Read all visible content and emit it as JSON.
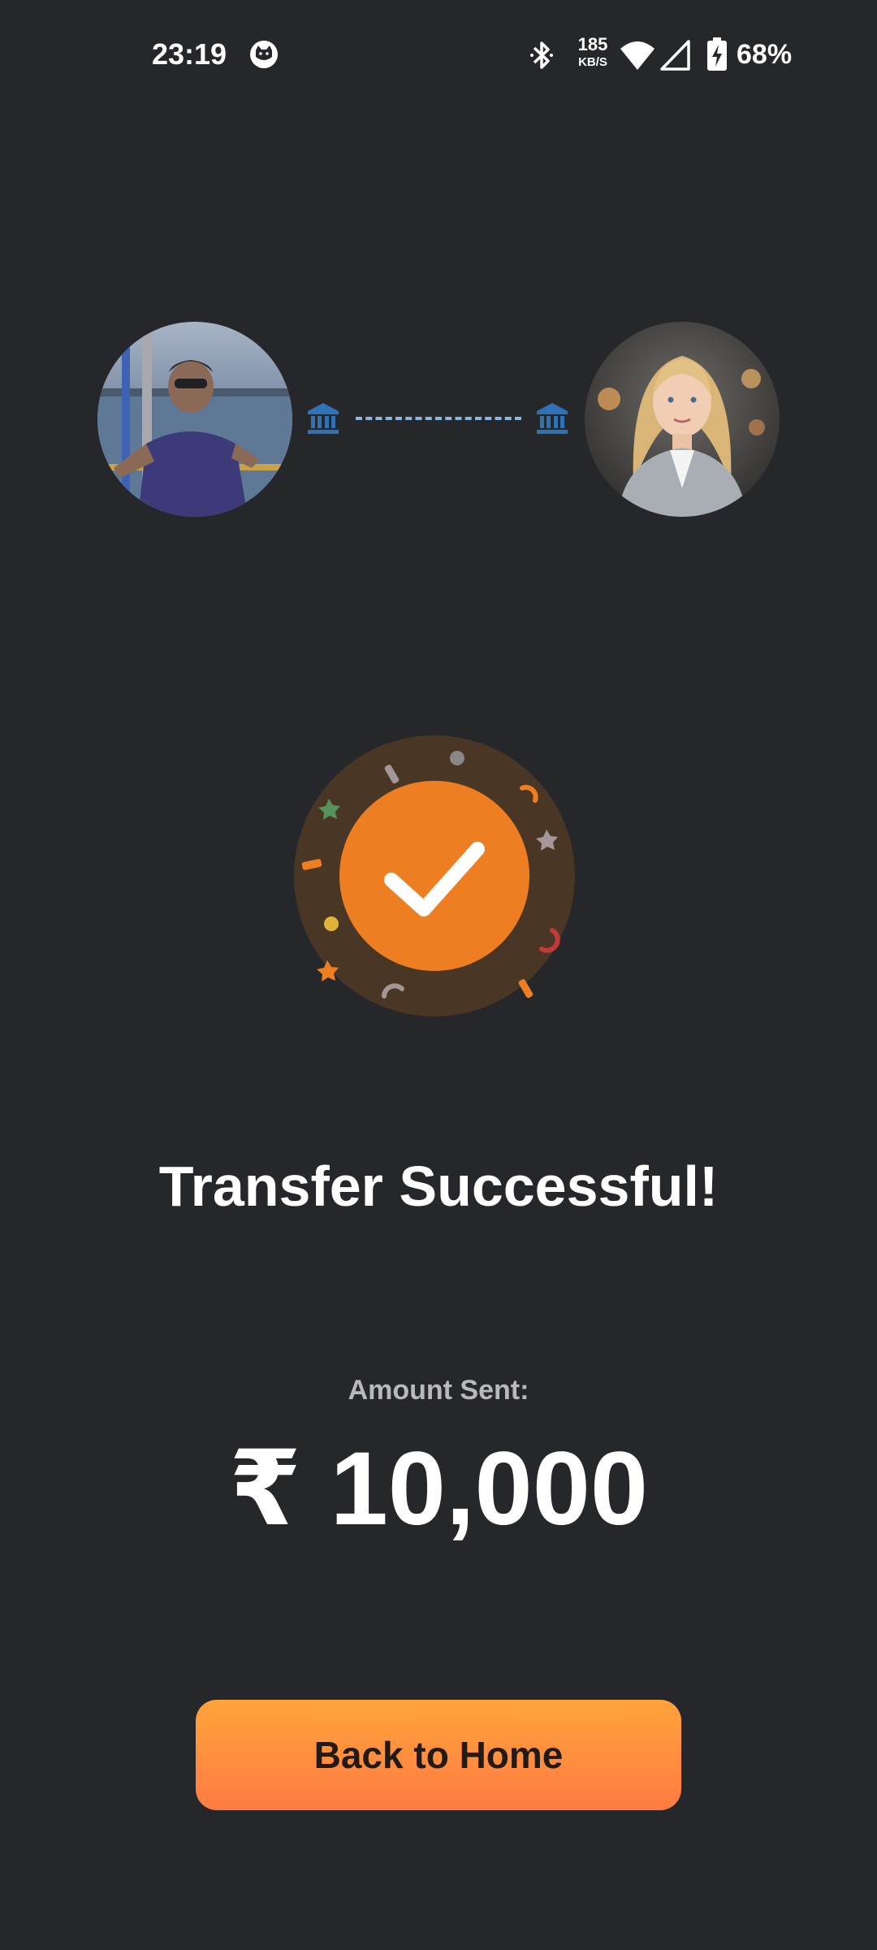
{
  "status_bar": {
    "time": "23:19",
    "net_speed_value": "185",
    "net_speed_unit": "KB/S",
    "battery_percent": "68%",
    "icons": [
      "cat-icon",
      "bluetooth-icon",
      "wifi-icon",
      "signal-icon",
      "battery-charging-icon"
    ]
  },
  "transfer": {
    "sender_avatar": "sender-avatar",
    "receiver_avatar": "receiver-avatar",
    "bank_icon": "bank-icon",
    "line_color": "#8ab6e2",
    "bank_color": "#2f72b5"
  },
  "success": {
    "icon": "check-icon",
    "accent_color": "#ee7e22",
    "halo_color": "#4a3625"
  },
  "headline": "Transfer Successful!",
  "amount": {
    "label": "Amount Sent:",
    "value": "₹ 10,000"
  },
  "actions": {
    "back_home_label": "Back to Home",
    "button_gradient": [
      "#ffa43a",
      "#ff7a43"
    ]
  }
}
